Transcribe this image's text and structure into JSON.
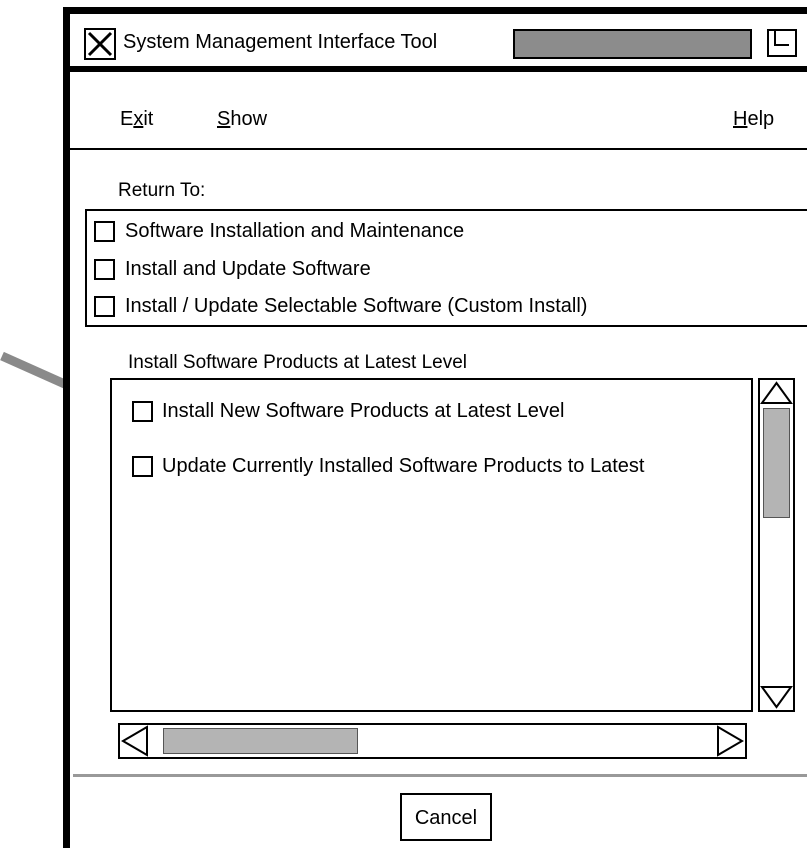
{
  "window": {
    "title": "System Management Interface Tool"
  },
  "menu": {
    "exit": {
      "pre": "E",
      "mnemonic": "x",
      "post": "it"
    },
    "show": {
      "mnemonic": "S",
      "post": "how"
    },
    "help": {
      "mnemonic": "H",
      "post": "elp"
    }
  },
  "return_to": {
    "label": "Return To:",
    "items": [
      {
        "label": "Software Installation and Maintenance"
      },
      {
        "label": "Install and Update Software"
      },
      {
        "label": "Install / Update Selectable Software (Custom Install)"
      }
    ]
  },
  "products": {
    "label": "Install Software Products at Latest Level",
    "items": [
      {
        "label": "Install New Software Products at Latest Level"
      },
      {
        "label": "Update Currently Installed Software Products to Latest"
      }
    ]
  },
  "footer": {
    "cancel_label": "Cancel"
  },
  "colors": {
    "title_gauge": "#8c8c8c",
    "scroll_thumb": "#b4b4b4",
    "divider": "#999999",
    "arrow": "#8a8a8a"
  }
}
